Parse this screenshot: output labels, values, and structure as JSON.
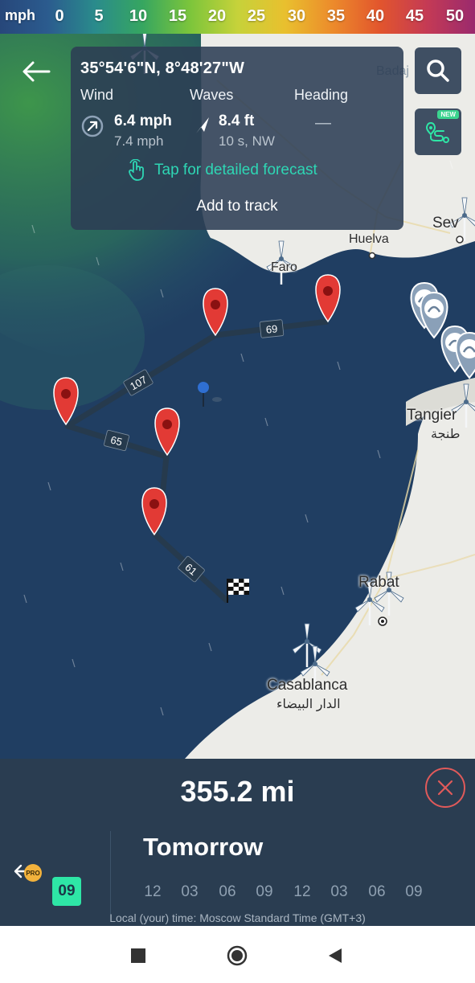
{
  "legend": {
    "unit": "mph",
    "ticks": [
      "0",
      "5",
      "10",
      "15",
      "20",
      "25",
      "30",
      "35",
      "40",
      "45",
      "50"
    ]
  },
  "map": {
    "places": {
      "huelva": "Huelva",
      "faro": "Faro",
      "sevilla_partial": "Sev",
      "badajoz_partial": "Badaj",
      "tangier": "Tangier",
      "tangier_ar": "طنجة",
      "rabat": "Rabat",
      "casablanca": "Casablanca",
      "casablanca_ar": "الدار البيضاء"
    },
    "segments": [
      "107",
      "69",
      "65",
      "61"
    ]
  },
  "info_card": {
    "coordinates": "35°54'6\"N, 8°48'27\"W",
    "wind_label": "Wind",
    "waves_label": "Waves",
    "heading_label": "Heading",
    "wind_speed": "6.4 mph",
    "wind_gust": "7.4 mph",
    "wave_height": "8.4 ft",
    "wave_detail": "10 s,  NW",
    "heading_value": "—",
    "forecast_link": "Tap for detailed forecast",
    "add_track": "Add to track"
  },
  "buttons": {
    "new_badge": "NEW"
  },
  "bottom": {
    "distance": "355.2 mi",
    "day": "Tomorrow",
    "pro_badge": "PRO",
    "selected_hour": "09",
    "hours": [
      "12",
      "03",
      "06",
      "09",
      "12",
      "03",
      "06",
      "09"
    ],
    "timezone": "Local (your) time: Moscow Standard Time (GMT+3)"
  },
  "colors": {
    "panel_bg": "#2a3d51",
    "accent_green": "#2ee6a6",
    "forecast_link": "#2ed6b4",
    "pin_red": "#e23a35",
    "close_red": "#e05a5a"
  },
  "icons": {
    "back": "arrow-left-icon",
    "search": "search-icon",
    "route": "route-planner-icon",
    "close": "close-icon",
    "wind_dir": "wind-direction-icon",
    "wave_dir": "wave-direction-icon",
    "tap": "hand-tap-icon",
    "finish": "checkered-flag-icon",
    "turbine": "wind-turbine-icon"
  }
}
